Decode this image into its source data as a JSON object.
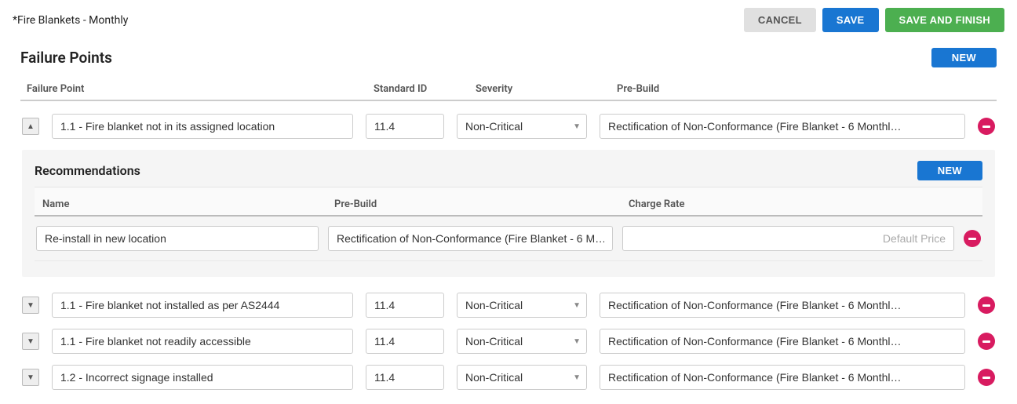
{
  "page_title": "*Fire Blankets - Monthly",
  "buttons": {
    "cancel": "CANCEL",
    "save": "SAVE",
    "save_finish": "SAVE AND FINISH",
    "new": "NEW"
  },
  "failure_points": {
    "title": "Failure Points",
    "columns": {
      "failure_point": "Failure Point",
      "standard_id": "Standard ID",
      "severity": "Severity",
      "pre_build": "Pre-Build"
    },
    "rows": [
      {
        "expanded": true,
        "failure_point": "1.1 - Fire blanket not in its assigned location",
        "standard_id": "11.4",
        "severity": "Non-Critical",
        "pre_build": "Rectification of Non-Conformance (Fire Blanket - 6 Monthl…"
      },
      {
        "expanded": false,
        "failure_point": "1.1 - Fire blanket not installed as per AS2444",
        "standard_id": "11.4",
        "severity": "Non-Critical",
        "pre_build": "Rectification of Non-Conformance (Fire Blanket - 6 Monthl…"
      },
      {
        "expanded": false,
        "failure_point": "1.1 - Fire blanket not readily accessible",
        "standard_id": "11.4",
        "severity": "Non-Critical",
        "pre_build": "Rectification of Non-Conformance (Fire Blanket - 6 Monthl…"
      },
      {
        "expanded": false,
        "failure_point": "1.2 - Incorrect signage installed",
        "standard_id": "11.4",
        "severity": "Non-Critical",
        "pre_build": "Rectification of Non-Conformance (Fire Blanket - 6 Monthl…"
      }
    ]
  },
  "recommendations": {
    "title": "Recommendations",
    "columns": {
      "name": "Name",
      "pre_build": "Pre-Build",
      "charge_rate": "Charge Rate"
    },
    "rows": [
      {
        "name": "Re-install in new location",
        "pre_build": "Rectification of Non-Conformance (Fire Blanket - 6 M…",
        "charge_rate": "",
        "charge_rate_placeholder": "Default Price"
      }
    ]
  }
}
